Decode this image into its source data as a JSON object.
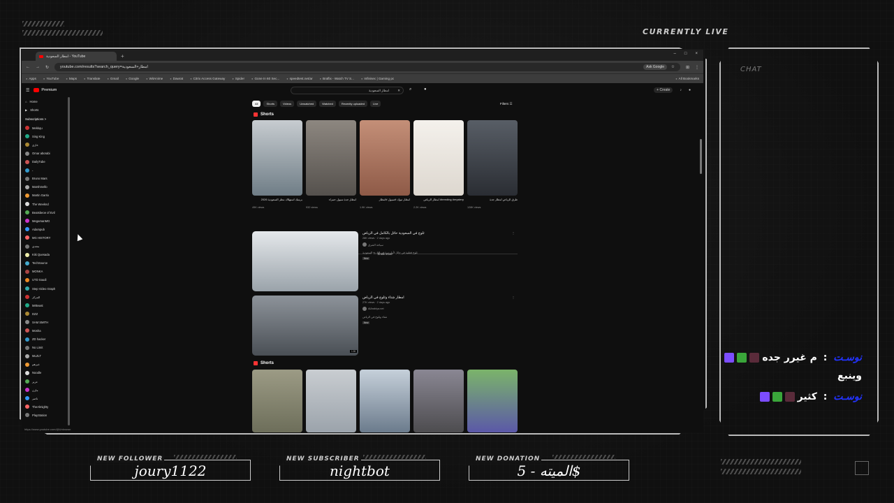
{
  "overlay": {
    "currently_live": "CURRENTLY LIVE",
    "chat_label": "CHAT",
    "chat_messages": [
      {
        "user": "نوسـت",
        "text": "م غيرر جده",
        "sep": " : "
      },
      {
        "user": "",
        "text": "وينبع",
        "sep": ""
      },
      {
        "user": "نوسـت",
        "text": "كثير",
        "sep": " : "
      }
    ],
    "alerts": [
      {
        "label": "NEW FOLLOWER",
        "value": "joury1122"
      },
      {
        "label": "NEW SUBSCRIBER",
        "value": "nightbot"
      },
      {
        "label": "NEW DONATION",
        "value": "الميته - 5$"
      }
    ]
  },
  "browser": {
    "tab_title": "امطار السعودية - YouTube",
    "new_tab": "+",
    "window_controls": [
      "–",
      "□",
      "×"
    ],
    "url": "youtube.com/results?search_query=امطار+السعودية",
    "ask_google": "Ask Google",
    "bookmarks": [
      "Apps",
      "YouTube",
      "Maps",
      "Translate",
      "Gmail",
      "Google",
      "WitAnime",
      "Dawrat",
      "Citrix Access Gateway",
      "Spider",
      "Gone In 60 Sec...",
      "speedtest.net/ar",
      "Braflix - Watch TV S...",
      "Infinisec | Gaming pc"
    ],
    "all_bookmarks": "All Bookmarks"
  },
  "youtube": {
    "logo": "Premium",
    "search_value": "امطار السعودية",
    "create": "+ Create",
    "sidebar": {
      "top_items": [
        "Home",
        "Shorts"
      ],
      "subscriptions_header": "Subscriptions  >",
      "subscriptions": [
        "Mekkqu",
        "Sing King",
        "غازي",
        "Omar aborabi",
        "DailyTube",
        "ـ",
        "Bruno Mars",
        "Marshmello",
        "Martin Garrix",
        "The Weeknd",
        "Beatsbeoe of Evil",
        "MegamanMG",
        "Adampub",
        "MG HISTORY",
        "مجدي",
        "Kiki Quesada",
        "TechSource",
        "MONKA",
        "UTD Saudi",
        "Step Video Graph",
        "المركز",
        "MrBeast",
        "DZZ",
        "SAM SMITH",
        "Mosha",
        "ZD hacker",
        "No Limit",
        "MLZLT",
        "غيرهم",
        "Noodle",
        "عزيز",
        "مازن",
        "ناصر",
        "TheAlmighty",
        "PlayStation"
      ]
    },
    "chips": [
      "All",
      "Shorts",
      "Videos",
      "Unwatched",
      "Watched",
      "Recently uploaded",
      "Live"
    ],
    "filters": "Filters",
    "shorts_title": "Shorts",
    "shorts_row1": [
      {
        "title": "بريتيك استهلاك مطر السعودية 2026",
        "views": "49K views",
        "color1": "#6f7d86",
        "color2": "#c7ccd0"
      },
      {
        "title": "امطار جدة سيول حمراء",
        "views": "932 views",
        "color1": "#55514d",
        "color2": "#8d8780"
      },
      {
        "title": "امطار تبوك #سيول #امطار",
        "views": "1.9K views",
        "color1": "#8e5a47",
        "color2": "#c48f78"
      },
      {
        "title": "امطار الرياض #trending #mystery",
        "views": "2.2K views",
        "color1": "#ddd7cf",
        "color2": "#f4f1ec"
      },
      {
        "title": "طرق الرياض امطار جدة",
        "views": "128K views",
        "color1": "#2a2d33",
        "color2": "#585e66"
      }
    ],
    "show_more": "Show more",
    "videos": [
      {
        "title": "ثلوج في السعودية حائل بالكامل في الرياض",
        "meta": "28K views · 2 days ago",
        "channel": "سياحة الشرق",
        "desc": "ثلوج قطنية في حائل لأول مرة في التاريخ السعودية",
        "badge": "New",
        "color1": "#9aa3aa",
        "color2": "#e5e8eb"
      },
      {
        "title": "امطار شتاء وثلوج في الرياض",
        "meta": "27K views · 2 days ago",
        "channel": "AlArabiya.net",
        "desc": "شتاء وثلوج في الرياض",
        "badge": "New",
        "duration": "1:26",
        "color1": "#4a4f55",
        "color2": "#8d939a"
      }
    ],
    "shorts_row2": [
      {
        "color1": "#6d6e5a",
        "color2": "#9c9b85"
      },
      {
        "color1": "#9ba3ab",
        "color2": "#c9cdd1"
      },
      {
        "color1": "#6b7b8c",
        "color2": "#c6d0da"
      },
      {
        "color1": "#4d4c4f",
        "color2": "#8a8793"
      },
      {
        "color1": "#5b58a8",
        "color2": "#7bb46a"
      }
    ],
    "status_url": "https://www.youtube.com/@Unknown"
  }
}
